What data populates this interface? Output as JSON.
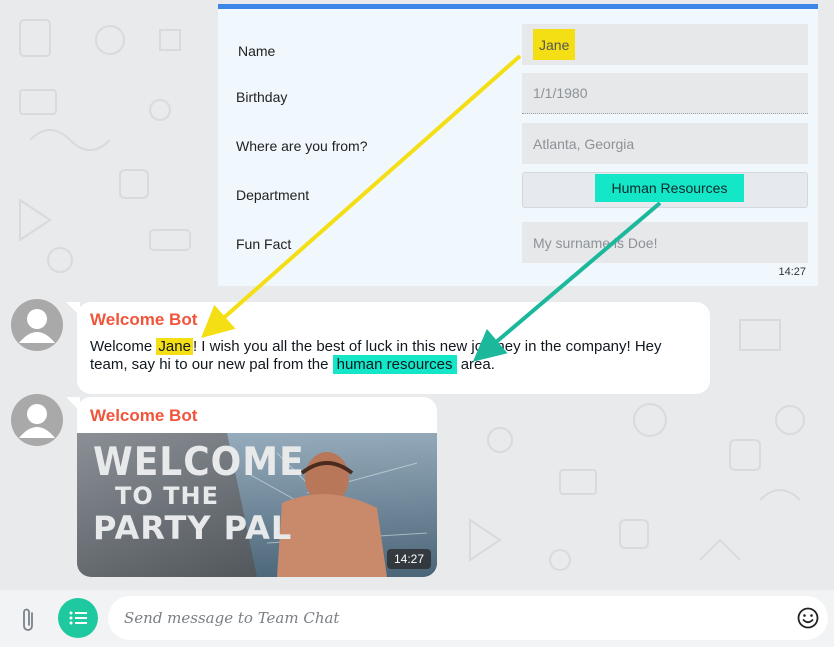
{
  "form": {
    "labels": {
      "name": "Name",
      "birthday": "Birthday",
      "origin": "Where are you from?",
      "department": "Department",
      "fun_fact": "Fun Fact"
    },
    "values": {
      "name": "Jane",
      "birthday": "1/1/1980",
      "origin": "Atlanta, Georgia",
      "department": "Human Resources",
      "fun_fact": "My surname is Doe!"
    },
    "time": "14:27"
  },
  "messages": [
    {
      "sender": "Welcome Bot",
      "text_before_name": "Welcome ",
      "name": "Jane",
      "text_after_name": "! I wish you all the best of luck in this new journey in the company! Hey team, say hi to our new pal from the ",
      "department": "human resources",
      "text_end": " area."
    },
    {
      "sender": "Welcome Bot",
      "gif_lines": [
        "WELCOME",
        "TO THE",
        "PARTY PAL"
      ],
      "time": "14:27"
    }
  ],
  "composer": {
    "placeholder": "Send message to Team Chat"
  },
  "icons": {
    "attach": "paperclip-icon",
    "menu": "list-icon",
    "emoji": "smiley-icon"
  },
  "colors": {
    "accent": "#3b86e6",
    "sender": "#f0553c",
    "highlight_yellow": "#f4df14",
    "highlight_cyan": "#14e6c8",
    "menu_button": "#1ec99f"
  }
}
